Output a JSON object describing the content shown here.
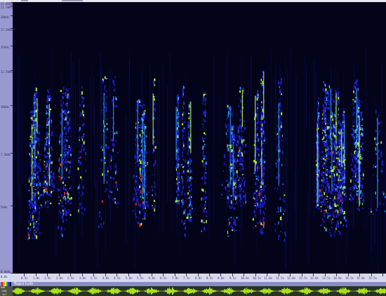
{
  "frequency_axis": {
    "ticks": [
      {
        "label": "22.05kHz",
        "level": 0.0
      },
      {
        "label": "21.5kHz",
        "level": 0.012
      },
      {
        "label": "20kHz",
        "level": 0.05
      },
      {
        "label": "17.5kHz",
        "level": 0.095
      },
      {
        "label": "15kHz",
        "level": 0.16
      },
      {
        "label": "12.5kHz",
        "level": 0.25
      },
      {
        "label": "10kHz",
        "level": 0.38
      },
      {
        "label": "7.5kHz",
        "level": 0.555
      },
      {
        "label": "5kHz",
        "level": 0.75
      },
      {
        "label": "0.0kHz",
        "level": 1.0
      }
    ]
  },
  "time_axis": {
    "origin_label": "0.0s",
    "ticks": [
      "0.5s",
      "1.0s",
      "1.5s",
      "2.0s",
      "2.5s",
      "3.0s",
      "3.5s",
      "4.0s",
      "4.5s",
      "5.0s",
      "5.5s",
      "6.0s",
      "6.5s",
      "7.0s",
      "7.5s",
      "8.0s",
      "8.5s",
      "9.0s",
      "9.5s",
      "10.0s",
      "10.5s",
      "11.0s",
      "11.5s",
      "12.0s",
      "12.5s",
      "13.0s",
      "13.5s",
      "14.0s",
      "14.5s",
      "15.0s",
      "15.5s",
      "16.0s"
    ]
  },
  "scale": {
    "label": "Magnitude",
    "swatch_colors": [
      "#ff0000",
      "#ffaa00",
      "#ffff00",
      "#00cc44",
      "#2233ff",
      "#000060"
    ]
  },
  "waveform": {
    "labels": [
      "0dB",
      "-6dB",
      "-Inf"
    ]
  },
  "colors": {
    "background": "#03031a",
    "low": "#1f1fd0",
    "mid": "#2aa0ff",
    "high": "#b8ff30",
    "peak": "#ff3010",
    "wave": "#a8e020"
  }
}
